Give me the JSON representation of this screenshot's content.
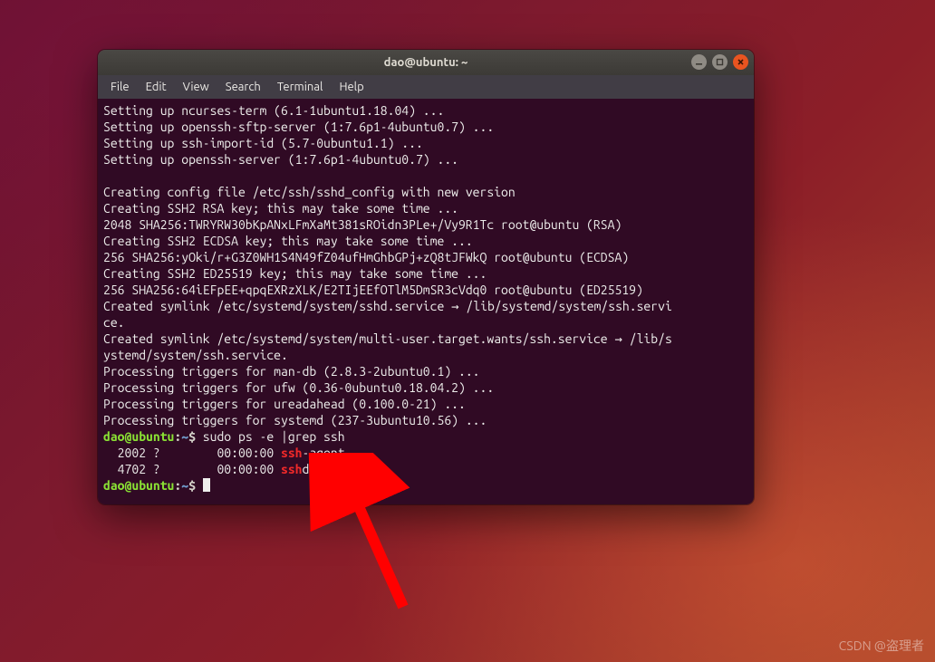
{
  "window": {
    "title": "dao@ubuntu: ~"
  },
  "menu": {
    "file": "File",
    "edit": "Edit",
    "view": "View",
    "search": "Search",
    "terminal": "Terminal",
    "help": "Help"
  },
  "prompt": {
    "userhost": "dao@ubuntu",
    "colon": ":",
    "path": "~",
    "dollar": "$"
  },
  "cmd1": " sudo ps -e |grep ssh",
  "output": {
    "l1": "Setting up ncurses-term (6.1-1ubuntu1.18.04) ...",
    "l2": "Setting up openssh-sftp-server (1:7.6p1-4ubuntu0.7) ...",
    "l3": "Setting up ssh-import-id (5.7-0ubuntu1.1) ...",
    "l4": "Setting up openssh-server (1:7.6p1-4ubuntu0.7) ...",
    "blank": "",
    "l5": "Creating config file /etc/ssh/sshd_config with new version",
    "l6": "Creating SSH2 RSA key; this may take some time ...",
    "l7": "2048 SHA256:TWRYRW30bKpANxLFmXaMt381sROidn3PLe+/Vy9R1Tc root@ubuntu (RSA)",
    "l8": "Creating SSH2 ECDSA key; this may take some time ...",
    "l9": "256 SHA256:yOki/r+G3Z0WH1S4N49fZ04ufHmGhbGPj+zQ8tJFWkQ root@ubuntu (ECDSA)",
    "l10": "Creating SSH2 ED25519 key; this may take some time ...",
    "l11": "256 SHA256:64iEFpEE+qpqEXRzXLK/E2TIjEEfOTlM5DmSR3cVdq0 root@ubuntu (ED25519)",
    "l12": "Created symlink /etc/systemd/system/sshd.service → /lib/systemd/system/ssh.servi",
    "l12b": "ce.",
    "l13": "Created symlink /etc/systemd/system/multi-user.target.wants/ssh.service → /lib/s",
    "l13b": "ystemd/system/ssh.service.",
    "l14": "Processing triggers for man-db (2.8.3-2ubuntu0.1) ...",
    "l15": "Processing triggers for ufw (0.36-0ubuntu0.18.04.2) ...",
    "l16": "Processing triggers for ureadahead (0.100.0-21) ...",
    "l17": "Processing triggers for systemd (237-3ubuntu10.56) ..."
  },
  "ps": {
    "row1_pre": "  2002 ?        00:00:00 ",
    "row1_hl": "ssh",
    "row1_post": "-agent",
    "row2_pre": "  4702 ?        00:00:00 ",
    "row2_hl": "ssh",
    "row2_post": "d"
  },
  "watermark": "CSDN @盗理者"
}
